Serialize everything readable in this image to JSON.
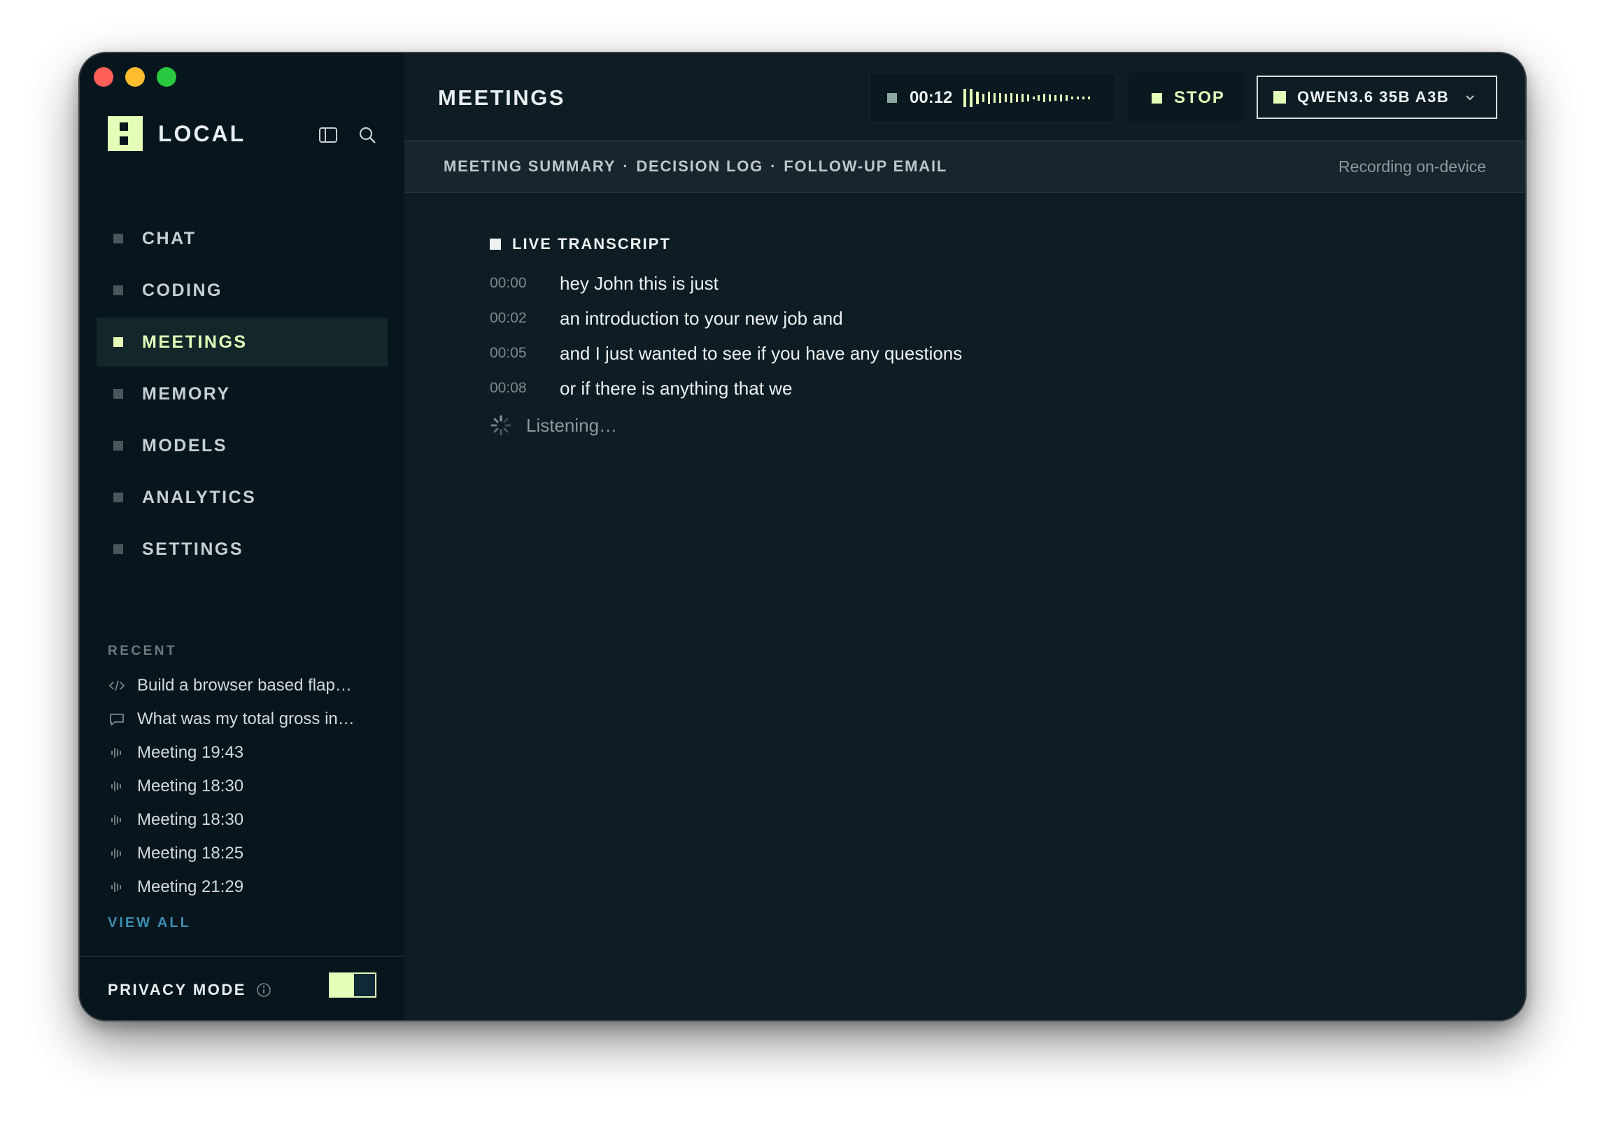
{
  "sidebar": {
    "brand": "LOCAL",
    "nav": [
      {
        "label": "CHAT"
      },
      {
        "label": "CODING"
      },
      {
        "label": "MEETINGS"
      },
      {
        "label": "MEMORY"
      },
      {
        "label": "MODELS"
      },
      {
        "label": "ANALYTICS"
      },
      {
        "label": "SETTINGS"
      }
    ],
    "recent_title": "RECENT",
    "recent": [
      {
        "label": "Build a browser based flap…",
        "icon": "code-icon"
      },
      {
        "label": "What was my total gross in…",
        "icon": "chat-bubble-icon"
      },
      {
        "label": "Meeting 19:43",
        "icon": "waveform-icon"
      },
      {
        "label": "Meeting 18:30",
        "icon": "waveform-icon"
      },
      {
        "label": "Meeting 18:30",
        "icon": "waveform-icon"
      },
      {
        "label": "Meeting 18:25",
        "icon": "waveform-icon"
      },
      {
        "label": "Meeting 21:29",
        "icon": "waveform-icon"
      }
    ],
    "view_all": "VIEW ALL",
    "privacy_label": "PRIVACY MODE"
  },
  "header": {
    "title": "MEETINGS",
    "rec_time": "00:12",
    "stop_label": "STOP",
    "model_label": "QWEN3.6 35B A3B"
  },
  "subbar": {
    "links": [
      "MEETING SUMMARY",
      "DECISION LOG",
      "FOLLOW-UP EMAIL"
    ],
    "separator": "·",
    "status": "Recording on-device"
  },
  "transcript": {
    "title": "LIVE TRANSCRIPT",
    "lines": [
      {
        "ts": "00:00",
        "text": "hey John this is just"
      },
      {
        "ts": "00:02",
        "text": "an introduction to your new job and"
      },
      {
        "ts": "00:05",
        "text": "and I just wanted to see if you have any questions"
      },
      {
        "ts": "00:08",
        "text": "or if there is anything that we"
      }
    ],
    "listening": "Listening…"
  },
  "colors": {
    "accent": "#e3ffb8",
    "sidebar_bg": "#07151d",
    "main_bg": "#0e1c24",
    "link": "#3a8fb0"
  }
}
